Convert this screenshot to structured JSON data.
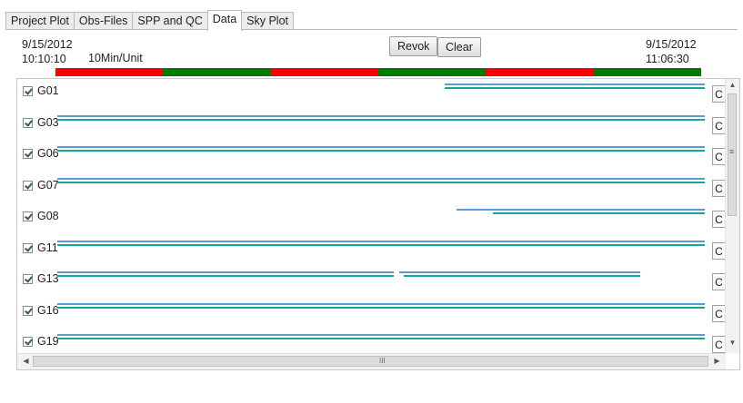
{
  "tabs": [
    {
      "label": "Project Plot",
      "active": false
    },
    {
      "label": "Obs-Files",
      "active": false
    },
    {
      "label": "SPP and QC",
      "active": false
    },
    {
      "label": "Data",
      "active": true
    },
    {
      "label": "Sky Plot",
      "active": false
    }
  ],
  "header": {
    "start_date": "9/15/2012",
    "start_time": "10:10:10",
    "unit": "10Min/Unit",
    "end_date": "9/15/2012",
    "end_time": "11:06:30",
    "revok_label": "Revok",
    "clear_label": "Clear"
  },
  "colors": {
    "red": "#ff0000",
    "green": "#007a00",
    "blue": "#5b9bd5",
    "teal": "#17a89a"
  },
  "timeline_segments": [
    "red",
    "green",
    "red",
    "green",
    "red",
    "green"
  ],
  "satellites": [
    {
      "id": "G01",
      "checked": true,
      "c_label": "C",
      "tracks": [
        {
          "color": "blue",
          "from": 0.599,
          "to": 1.0
        },
        {
          "color": "teal",
          "from": 0.599,
          "to": 1.0
        }
      ]
    },
    {
      "id": "G03",
      "checked": true,
      "c_label": "C",
      "tracks": [
        {
          "color": "blue",
          "from": 0.0,
          "to": 1.0
        },
        {
          "color": "teal",
          "from": 0.0,
          "to": 1.0
        }
      ]
    },
    {
      "id": "G06",
      "checked": true,
      "c_label": "C",
      "tracks": [
        {
          "color": "blue",
          "from": 0.0,
          "to": 1.0
        },
        {
          "color": "teal",
          "from": 0.0,
          "to": 1.0
        }
      ]
    },
    {
      "id": "G07",
      "checked": true,
      "c_label": "C",
      "tracks": [
        {
          "color": "blue",
          "from": 0.0,
          "to": 1.0
        },
        {
          "color": "teal",
          "from": 0.0,
          "to": 1.0
        }
      ]
    },
    {
      "id": "G08",
      "checked": true,
      "c_label": "C",
      "tracks": [
        {
          "color": "blue",
          "from": 0.617,
          "to": 1.0
        },
        {
          "color": "teal",
          "from": 0.673,
          "to": 1.0
        }
      ]
    },
    {
      "id": "G11",
      "checked": true,
      "c_label": "C",
      "tracks": [
        {
          "color": "blue",
          "from": 0.0,
          "to": 1.0
        },
        {
          "color": "teal",
          "from": 0.0,
          "to": 1.0
        }
      ]
    },
    {
      "id": "G13",
      "checked": true,
      "c_label": "C",
      "tracks": [
        {
          "color": "blue",
          "from": 0.0,
          "to": 0.52
        },
        {
          "color": "blue",
          "from": 0.528,
          "to": 0.9
        },
        {
          "color": "teal",
          "from": 0.0,
          "to": 0.52
        },
        {
          "color": "teal",
          "from": 0.535,
          "to": 0.9
        }
      ]
    },
    {
      "id": "G16",
      "checked": true,
      "c_label": "C",
      "tracks": [
        {
          "color": "blue",
          "from": 0.0,
          "to": 1.0
        },
        {
          "color": "teal",
          "from": 0.0,
          "to": 1.0
        }
      ]
    },
    {
      "id": "G19",
      "checked": true,
      "c_label": "C",
      "tracks": [
        {
          "color": "blue",
          "from": 0.0,
          "to": 1.0
        },
        {
          "color": "teal",
          "from": 0.0,
          "to": 1.0
        }
      ]
    }
  ],
  "scroll": {
    "h_grip": "III",
    "v_grip": "≡"
  }
}
